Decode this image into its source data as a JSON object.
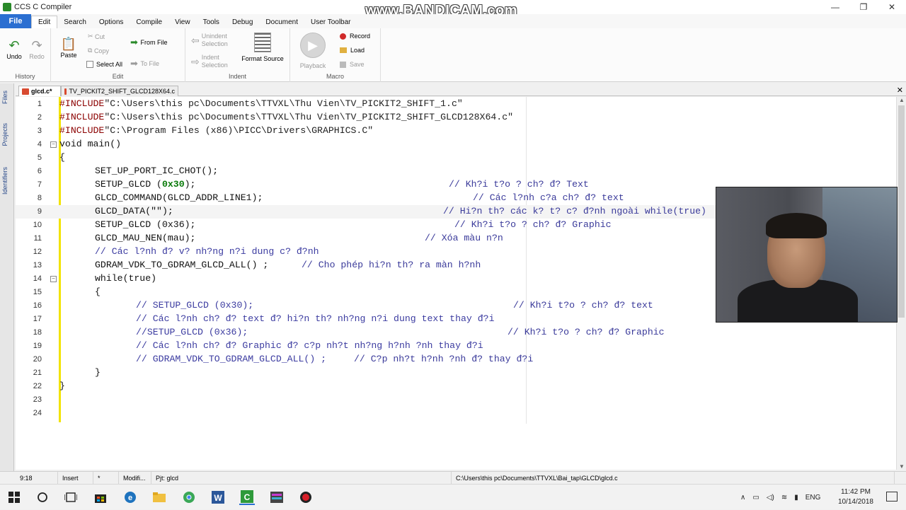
{
  "window": {
    "title": "CCS C Compiler",
    "watermark": "www.BANDICAM.com",
    "minimize": "—",
    "maximize": "❐",
    "close": "✕"
  },
  "menu": {
    "file": "File",
    "items": [
      "Edit",
      "Search",
      "Options",
      "Compile",
      "View",
      "Tools",
      "Debug",
      "Document",
      "User Toolbar"
    ]
  },
  "ribbon": {
    "history": {
      "label": "History",
      "undo": "Undo",
      "redo": "Redo"
    },
    "edit": {
      "label": "Edit",
      "paste": "Paste",
      "cut": "Cut",
      "copy": "Copy",
      "select_all": "Select All",
      "from_file": "From File",
      "to_file": "To File"
    },
    "indent": {
      "label": "Indent",
      "unindent": "Unindent Selection",
      "indent": "Indent Selection",
      "format_source": "Format Source"
    },
    "macro": {
      "label": "Macro",
      "playback": "Playback",
      "record": "Record",
      "load": "Load",
      "save": "Save"
    }
  },
  "tabs": [
    {
      "label": "glcd.c*",
      "active": true
    },
    {
      "label": "TV_PICKIT2_SHIFT_GLCD128X64.c",
      "active": false
    }
  ],
  "sidepanel": {
    "files": "Files",
    "projects": "Projects",
    "identifiers": "Identifiers"
  },
  "code": {
    "numbers": [
      "1",
      "2",
      "3",
      "4",
      "5",
      "6",
      "7",
      "8",
      "9",
      "10",
      "11",
      "12",
      "13",
      "14",
      "15",
      "16",
      "17",
      "18",
      "19",
      "20",
      "21",
      "22",
      "23",
      "24"
    ],
    "l1": "\"C:\\Users\\this pc\\Documents\\TTVXL\\Thu Vien\\TV_PICKIT2_SHIFT_1.c\"",
    "l2": "\"C:\\Users\\this pc\\Documents\\TTVXL\\Thu Vien\\TV_PICKIT2_SHIFT_GLCD128X64.c\"",
    "l3": "\"C:\\Program Files (x86)\\PICC\\Drivers\\GRAPHICS.C\"",
    "include": "#INCLUDE",
    "l4": "void main()",
    "l5": "{",
    "l6": "SET_UP_PORT_IC_CHOT();",
    "l7a": "SETUP_GLCD (",
    "l7hex": "0x30",
    "l7b": ");",
    "l7c": "// Kh?i t?o ? ch? đ? Text",
    "l8": "GLCD_COMMAND(GLCD_ADDR_LINE1);",
    "l8c": "// Các l?nh c?a ch? đ? text",
    "l9": "GLCD_DATA(\"\");",
    "l9c": "// Hi?n th? các k? t? c? đ?nh ngoài while(true)",
    "l10": "SETUP_GLCD (0x36);",
    "l10c": "// Kh?i t?o ? ch? đ? Graphic",
    "l11": "GLCD_MAU_NEN(mau);",
    "l11c": "// Xóa màu n?n",
    "l12": "// Các l?nh đ? v? nh?ng n?i dung c? đ?nh",
    "l13": "GDRAM_VDK_TO_GDRAM_GLCD_ALL() ;",
    "l13c": "// Cho phép hi?n th? ra màn h?nh",
    "l14": "while(true)",
    "l15": "{",
    "l16": "// SETUP_GLCD (0x30);",
    "l16c": "// Kh?i t?o ? ch? đ? text",
    "l17": "// Các l?nh ch? đ? text đ? hi?n th? nh?ng n?i dung text thay đ?i",
    "l18": "//SETUP_GLCD (0x36);",
    "l18c": "// Kh?i t?o ? ch? đ? Graphic",
    "l19": "// Các l?nh ch? đ? Graphic đ? c?p nh?t nh?ng h?nh ?nh thay đ?i",
    "l20": "// GDRAM_VDK_TO_GDRAM_GLCD_ALL() ;",
    "l20c": "// C?p nh?t h?nh ?nh đ? thay đ?i",
    "l21": "}",
    "l22": "}"
  },
  "status": {
    "position": "9:18",
    "mode": "Insert",
    "modified_marker": "*",
    "modified": "Modifi...",
    "project": "Pjt: glcd",
    "path": "C:\\Users\\this pc\\Documents\\TTVXL\\Bai_tap\\GLCD\\glcd.c"
  },
  "taskbar": {
    "language": "ENG",
    "time": "11:42 PM",
    "date": "10/14/2018"
  },
  "colors": {
    "file_menu": "#2b6fd1",
    "keyword": "#8b0000",
    "comment": "#3b3ba0",
    "hex": "#0a7a0a",
    "fold_bar": "#f2e300"
  }
}
